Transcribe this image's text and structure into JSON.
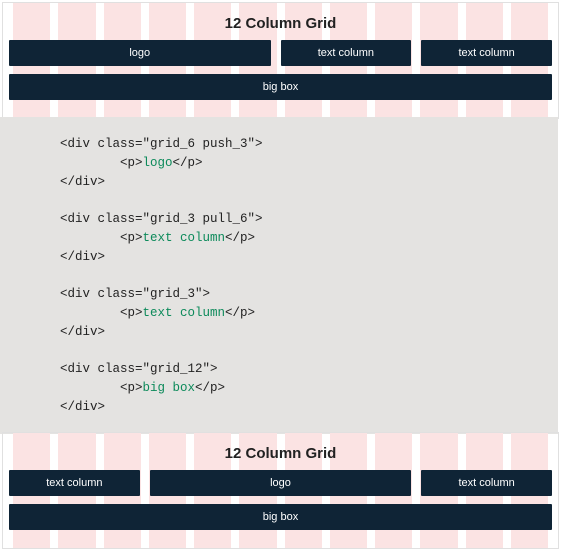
{
  "top_grid": {
    "title": "12 Column Grid",
    "row1": {
      "a": "logo",
      "b": "text column",
      "c": "text column"
    },
    "row2": {
      "a": "big box"
    }
  },
  "code": {
    "l1a": "<div class=\"grid_6 push_3\">",
    "l1b": "        <p>",
    "l1c": "logo",
    "l1d": "</p>",
    "l1e": "</div>",
    "l2a": "<div class=\"grid_3 pull_6\">",
    "l2b": "        <p>",
    "l2c": "text column",
    "l2d": "</p>",
    "l2e": "</div>",
    "l3a": "<div class=\"grid_3\">",
    "l3b": "        <p>",
    "l3c": "text column",
    "l3d": "</p>",
    "l3e": "</div>",
    "l4a": "<div class=\"grid_12\">",
    "l4b": "        <p>",
    "l4c": "big box",
    "l4d": "</p>",
    "l4e": "</div>"
  },
  "bottom_grid": {
    "title": "12 Column Grid",
    "row1": {
      "a": "text column",
      "b": "logo",
      "c": "text column"
    },
    "row2": {
      "a": "big box"
    }
  }
}
